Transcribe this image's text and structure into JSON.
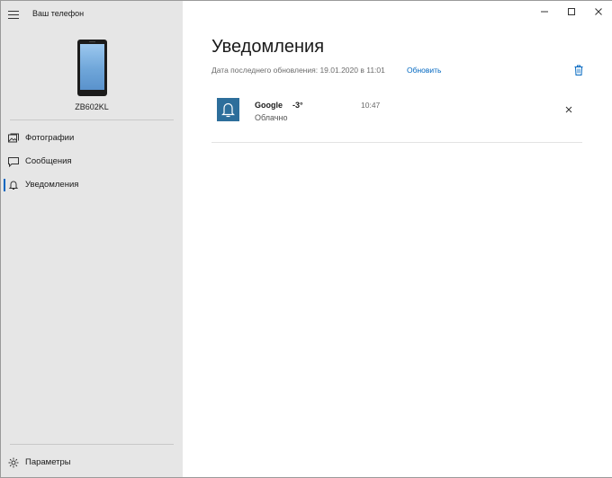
{
  "app": {
    "title": "Ваш телефон",
    "device_name": "ZB602KL"
  },
  "sidebar": {
    "items": [
      {
        "label": "Фотографии",
        "icon": "photos-icon"
      },
      {
        "label": "Сообщения",
        "icon": "messages-icon"
      },
      {
        "label": "Уведомления",
        "icon": "bell-icon",
        "active": true
      }
    ],
    "settings_label": "Параметры"
  },
  "main": {
    "title": "Уведомления",
    "last_updated": "Дата последнего обновления: 19.01.2020 в 11:01",
    "refresh_label": "Обновить"
  },
  "notifications": [
    {
      "app": "Google",
      "title": "-3°",
      "time": "10:47",
      "text": "Облачно",
      "icon": "bell-icon"
    }
  ],
  "colors": {
    "accent": "#0067c0",
    "sidebar_bg": "#e6e6e6",
    "notification_icon_bg": "#2d6e9b"
  }
}
